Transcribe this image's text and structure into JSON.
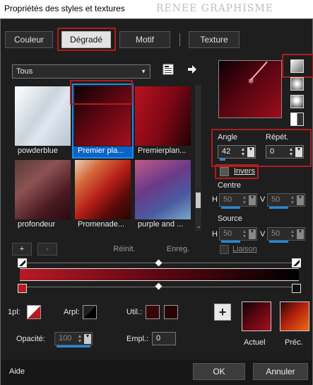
{
  "window": {
    "title": "Propriétés des styles et textures",
    "watermark": "RENEE GRAPHISME"
  },
  "tabs": [
    {
      "label": "Couleur"
    },
    {
      "label": "Dégradé"
    },
    {
      "label": "Motif"
    },
    {
      "label": "Texture"
    }
  ],
  "category": {
    "value": "Tous"
  },
  "gradients": [
    {
      "name": "powderblue"
    },
    {
      "name": "Premier pla..."
    },
    {
      "name": "Premierplan..."
    },
    {
      "name": "profondeur"
    },
    {
      "name": "Promenade..."
    },
    {
      "name": "purple and ..."
    }
  ],
  "list_buttons": {
    "add": "+",
    "remove": "-",
    "reset": "Réinit.",
    "save": "Enreg."
  },
  "controls": {
    "angle_label": "Angle",
    "angle_value": "42",
    "repeat_label": "Répét.",
    "repeat_value": "0",
    "invert_label": "Invers",
    "center_label": "Centre",
    "center_h_label": "H",
    "center_h": "50",
    "center_v_label": "V",
    "center_v": "50",
    "source_label": "Source",
    "source_h_label": "H",
    "source_h": "50",
    "source_v_label": "V",
    "source_v": "50",
    "link_label": "Liaison"
  },
  "bottom": {
    "first_label": "1pl:",
    "arpl_label": "Arpl:",
    "util_label": "Util.:",
    "opacity_label": "Opacité:",
    "opacity_value": "100",
    "empl_label": "Empl.:",
    "empl_value": "0",
    "add_button": "+",
    "current_label": "Actuel",
    "previous_label": "Préc."
  },
  "footer": {
    "help": "Aide",
    "ok": "OK",
    "cancel": "Annuler"
  },
  "colors": {
    "highlight": "#b01c1c",
    "selection": "#1e8ce6",
    "gradient_start": "#b81a24",
    "gradient_end": "#000000",
    "used_color_1": "#3a0508",
    "used_color_2": "#2a0305"
  }
}
